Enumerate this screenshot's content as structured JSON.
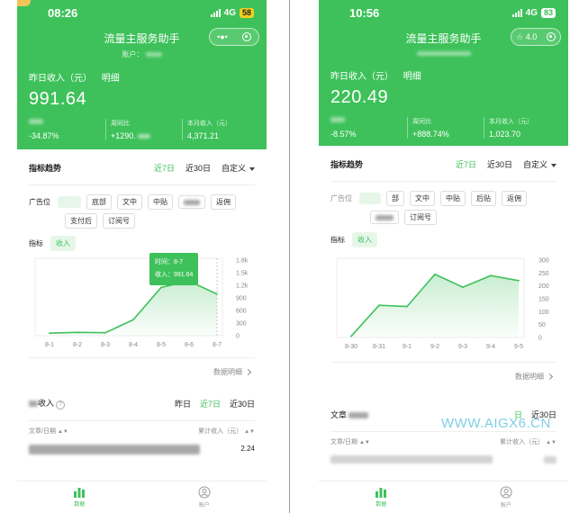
{
  "left": {
    "status": {
      "time": "08:26",
      "network": "4G",
      "battery": "58"
    },
    "title": "流量主服务助手",
    "account_label": "账户：",
    "yesterday_label": "昨日收入（元）",
    "detail_link": "明细",
    "yesterday_value": "991.64",
    "stats": [
      {
        "label": "",
        "value": "-34.87%"
      },
      {
        "label": "周同比",
        "value": "+1290."
      },
      {
        "label": "本月收入（元）",
        "value": "4,371.21"
      }
    ],
    "trend": {
      "title": "指标趋势",
      "tab_7": "近7日",
      "tab_30": "近30日",
      "custom": "自定义"
    },
    "chips_label": "广告位",
    "chips": [
      {
        "label": "",
        "on": true
      },
      {
        "label": "底部",
        "on": false
      },
      {
        "label": "文中",
        "on": false
      },
      {
        "label": "中贴",
        "on": false
      },
      {
        "label": "",
        "on": false
      },
      {
        "label": "返佣",
        "on": false
      },
      {
        "label": "支付后",
        "on": false
      },
      {
        "label": "订阅号",
        "on": false
      }
    ],
    "metric_label": "指标",
    "metric_chip": "收入",
    "tooltip": {
      "time": "时间：8-7",
      "income": "收入：991.64"
    },
    "more_link": "数据明细",
    "rank": {
      "title": "收入",
      "tab_y": "昨日",
      "tab_7": "近7日",
      "tab_30": "近30日"
    },
    "table": {
      "col1": "文章/日期",
      "col2": "累计收入（元）",
      "row_value": "2.24"
    },
    "nav": {
      "data": "数据",
      "account": "账户"
    }
  },
  "right": {
    "status": {
      "time": "10:56",
      "network": "4G",
      "battery": "83"
    },
    "title": "流量主服务助手",
    "capsule_text": "4.0",
    "yesterday_label": "昨日收入（元）",
    "detail_link": "明细",
    "yesterday_value": "220.49",
    "stats": [
      {
        "label": "",
        "value": "-8.57%"
      },
      {
        "label": "周同比",
        "value": "+888.74%"
      },
      {
        "label": "本月收入（元）",
        "value": "1,023.70"
      }
    ],
    "trend": {
      "title": "指标趋势",
      "tab_7": "近7日",
      "tab_30": "近30日",
      "custom": "自定义"
    },
    "chips_label": "广告位",
    "chips": [
      {
        "label": "",
        "on": true
      },
      {
        "label": "部",
        "on": false
      },
      {
        "label": "文中",
        "on": false
      },
      {
        "label": "中贴",
        "on": false
      },
      {
        "label": "后贴",
        "on": false
      },
      {
        "label": "返佣",
        "on": false
      },
      {
        "label": "",
        "on": false
      },
      {
        "label": "订阅号",
        "on": false
      }
    ],
    "metric_label": "指标",
    "metric_chip": "收入",
    "more_link": "数据明细",
    "rank": {
      "title": "文章",
      "tab_30": "近30日",
      "tab_7_partial": "日"
    },
    "table": {
      "col1": "文章/日期",
      "col2": "累计收入（元）"
    },
    "nav": {
      "data": "数据",
      "account": "账户"
    }
  },
  "watermark": "WWW.AIGX6.CN",
  "colors": {
    "accent": "#3ec15a",
    "battery_low": "#f2d21a",
    "watermark": "#7fcfe6"
  },
  "chart_data": [
    {
      "type": "area",
      "categories": [
        "8-1",
        "8-2",
        "8-3",
        "8-4",
        "8-5",
        "8-6",
        "8-7"
      ],
      "values": [
        60,
        80,
        70,
        380,
        1150,
        1300,
        991.64
      ],
      "yticks": [
        "1.8k",
        "1.5k",
        "1.2k",
        "900",
        "600",
        "300",
        "0"
      ],
      "ylim": [
        0,
        1800
      ]
    },
    {
      "type": "area",
      "categories": [
        "8-30",
        "8-31",
        "9-1",
        "9-2",
        "9-3",
        "9-4",
        "9-5"
      ],
      "values": [
        5,
        125,
        120,
        245,
        195,
        240,
        220.49
      ],
      "yticks": [
        "300",
        "250",
        "200",
        "150",
        "100",
        "50",
        "0"
      ],
      "ylim": [
        0,
        300
      ]
    }
  ]
}
